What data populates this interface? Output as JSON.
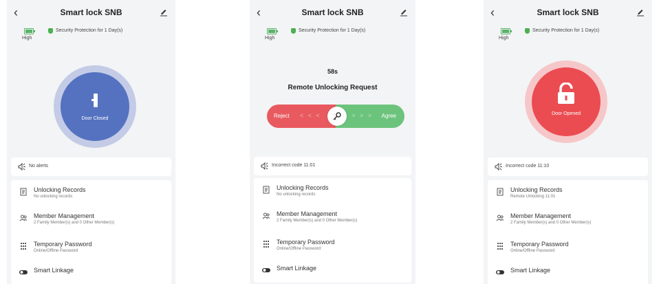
{
  "colors": {
    "closed_blue": "#5572c0",
    "opened_red": "#ea4c52",
    "reject_red": "#e85a5f",
    "agree_green": "#6cc47c",
    "shield_green": "#4caf50"
  },
  "screens": [
    {
      "title": "Smart lock SNB",
      "battery_label": "High",
      "security_text": "Security Protection for 1 Day(s)",
      "door_state": "Door Closed",
      "alert_text": "No alerts",
      "menu": [
        {
          "title": "Unlocking Records",
          "subtitle": "No unlocking records"
        },
        {
          "title": "Member Management",
          "subtitle": "2 Family Member(s) and 0 Other Member(s)"
        },
        {
          "title": "Temporary Password",
          "subtitle": "Online/Offline Password"
        },
        {
          "title": "Smart Linkage",
          "subtitle": ""
        }
      ]
    },
    {
      "title": "Smart lock SNB",
      "battery_label": "High",
      "security_text": "Security Protection for 1 Day(s)",
      "countdown": "58s",
      "request_title": "Remote Unlocking Request",
      "reject_label": "Reject",
      "agree_label": "Agree",
      "chevrons_left": "< < <",
      "chevrons_right": "> > >",
      "alert_text": "Incorrect code 11:01",
      "menu": [
        {
          "title": "Unlocking Records",
          "subtitle": "No unlocking records"
        },
        {
          "title": "Member Management",
          "subtitle": "2 Family Member(s) and 0 Other Member(s)"
        },
        {
          "title": "Temporary Password",
          "subtitle": "Online/Offline Password"
        },
        {
          "title": "Smart Linkage",
          "subtitle": ""
        }
      ]
    },
    {
      "title": "Smart lock SNB",
      "battery_label": "High",
      "security_text": "Security Protection for 1 Day(s)",
      "door_state": "Door Opened",
      "alert_text": "Incorrect code 11:10",
      "menu": [
        {
          "title": "Unlocking Records",
          "subtitle": "Remote Unlocking 11:01"
        },
        {
          "title": "Member Management",
          "subtitle": "2 Family Member(s) and 0 Other Member(s)"
        },
        {
          "title": "Temporary Password",
          "subtitle": "Online/Offline Password"
        },
        {
          "title": "Smart Linkage",
          "subtitle": ""
        }
      ]
    }
  ],
  "icons": {
    "back": "back-arrow-icon",
    "edit": "edit-pencil-icon",
    "battery": "battery-icon",
    "shield": "shield-icon",
    "lock_closed": "lock-closed-icon",
    "lock_open": "lock-open-icon",
    "key": "key-icon",
    "speaker": "speaker-icon",
    "records": "records-list-icon",
    "members": "members-icon",
    "password": "keypad-icon",
    "linkage": "toggle-icon"
  }
}
